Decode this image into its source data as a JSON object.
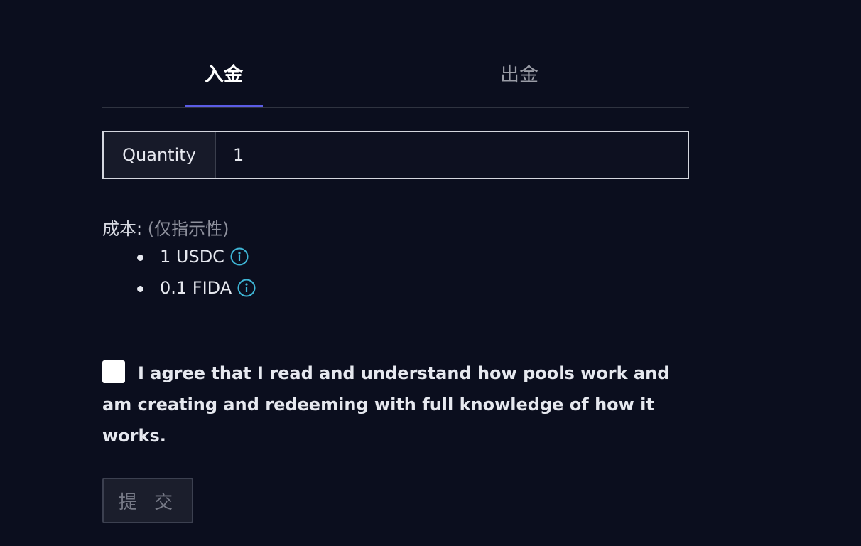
{
  "tabs": {
    "deposit": "入金",
    "withdraw": "出金"
  },
  "quantity": {
    "label": "Quantity",
    "value": "1"
  },
  "cost": {
    "title": "成本:",
    "hint": "(仅指示性)",
    "items": [
      {
        "text": "1 USDC",
        "icon": "info-circle-icon"
      },
      {
        "text": "0.1 FIDA",
        "icon": "info-circle-icon"
      }
    ]
  },
  "agreement": {
    "text": "I agree that I read and understand how pools work and am creating and redeeming with full knowledge of how it works.",
    "checked": false
  },
  "submit": {
    "label": "提 交",
    "disabled": true
  },
  "colors": {
    "background": "#0b0e1e",
    "accent": "#5b5ce6",
    "info_icon": "#3fb6d6"
  }
}
